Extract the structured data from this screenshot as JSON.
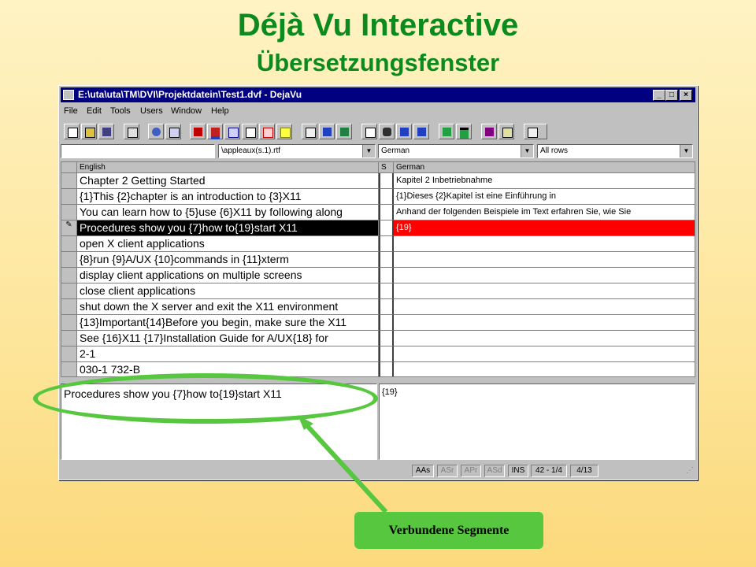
{
  "slide": {
    "title": "Déjà Vu Interactive",
    "subtitle": "Übersetzungsfenster",
    "callout": "Verbundene Segmente",
    "accent_color": "#0b8a1e",
    "highlight_color": "#57c73f"
  },
  "window": {
    "title": "E:\\uta\\uta\\TM\\DVI\\Projektdatein\\Test1.dvf - DejaVu",
    "menu": [
      "File",
      "Edit",
      "Tools",
      "Users",
      "Window",
      "Help"
    ],
    "toolbar_icons": [
      "new-icon",
      "open-icon",
      "save-icon",
      "properties-icon",
      "scan-icon",
      "checkmark-icon",
      "shapes-icon",
      "colors-icon",
      "sort-icon",
      "spellcheck-icon",
      "search-replace-icon",
      "arrow-right-icon",
      "preview-icon",
      "home-icon",
      "filter-icon",
      "table-icon",
      "binoculars-icon",
      "cursor-left-icon",
      "cursor-right-icon",
      "down-arrow-icon",
      "down-arrow-green-icon",
      "book-icon",
      "document-icon",
      "settings-icon"
    ]
  },
  "filters": {
    "file": "\\appleaux(s.1).rtf",
    "language": "German",
    "rows": "All rows"
  },
  "grid": {
    "headers": {
      "source": "English",
      "status": "S",
      "target": "German"
    },
    "rows": [
      {
        "source": "Chapter 2 Getting Started",
        "target": "Kapitel 2 Inbetriebnahme"
      },
      {
        "source": "{1}This {2}chapter is an introduction to {3}X11",
        "target": "{1}Dieses {2}Kapitel ist eine Einführung in"
      },
      {
        "source": "You can learn how to {5}use {6}X11 by following along",
        "target": "Anhand der folgenden Beispiele im Text erfahren Sie, wie Sie"
      },
      {
        "source": "Procedures show you {7}how to{19}start X11",
        "target": "{19}"
      },
      {
        "source": "open X client applications",
        "target": ""
      },
      {
        "source": "{8}run {9}A/UX {10}commands in {11}xterm",
        "target": ""
      },
      {
        "source": "display client applications on multiple screens",
        "target": ""
      },
      {
        "source": "close client applications",
        "target": ""
      },
      {
        "source": "shut down the X server and exit the X11 environment",
        "target": ""
      },
      {
        "source": "{13}Important{14}Before you begin, make sure the X11",
        "target": ""
      },
      {
        "source": "See {16}X11 {17}Installation Guide for A/UX{18} for",
        "target": ""
      },
      {
        "source": "2-1",
        "target": ""
      },
      {
        "source": "030-1 732-B",
        "target": ""
      }
    ]
  },
  "editor": {
    "source_text": "Procedures show you {7}how to{19}start X11",
    "target_text": "{19}"
  },
  "status_bar": {
    "aas": "AAs",
    "asr": "ASr",
    "apr": "APr",
    "asd": "ASd",
    "ins": "INS",
    "position": "42 - 1/4",
    "count": "4/13"
  }
}
